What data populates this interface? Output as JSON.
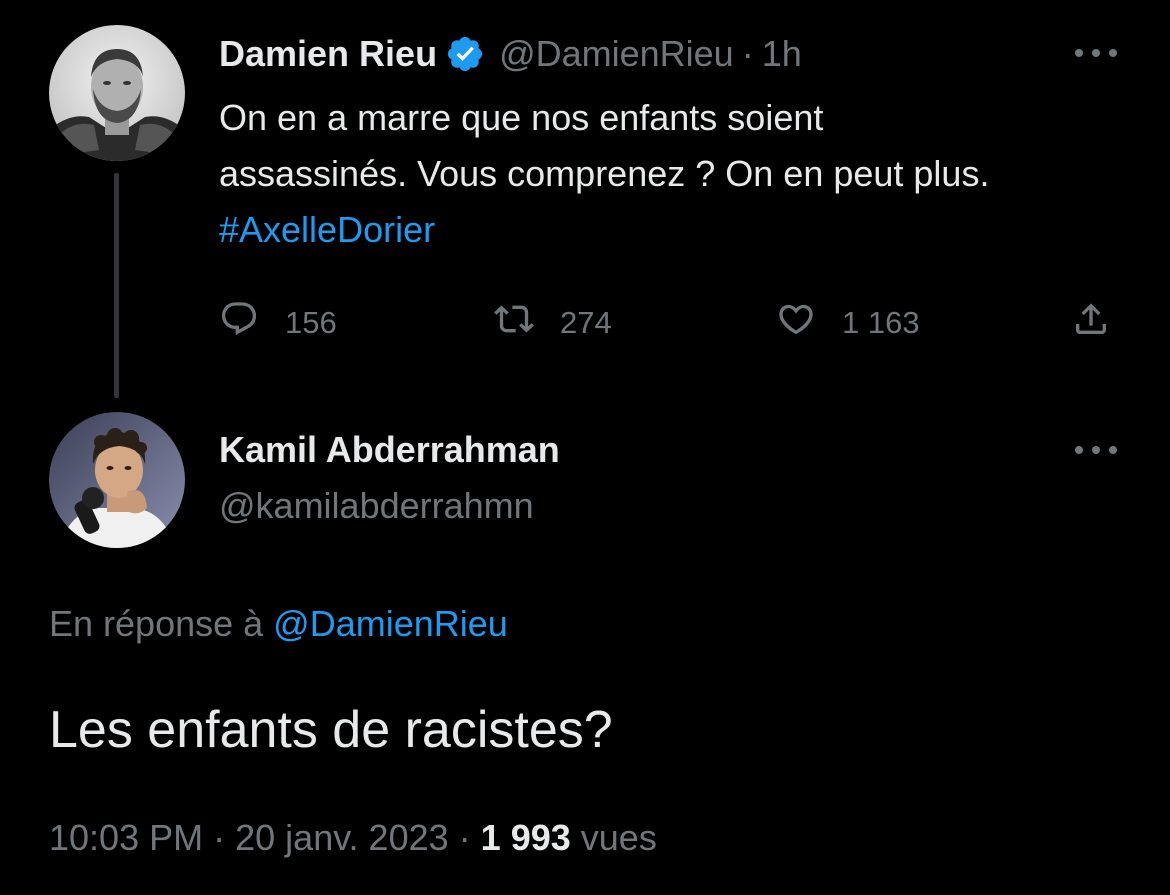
{
  "colors": {
    "background": "#000000",
    "text_primary": "#e7e9ea",
    "text_secondary": "#71767b",
    "accent": "#1d9bf0",
    "thread_line": "#333639"
  },
  "parent_tweet": {
    "display_name": "Damien Rieu",
    "verified_icon": "verified-badge-icon",
    "handle": "@DamienRieu",
    "separator": "·",
    "time_ago": "1h",
    "more_icon": "more-options-icon",
    "text_line1": "On en a marre que nos enfants soient",
    "text_line2": "assassinés. Vous comprenez ? On en peut plus.",
    "hashtag": "#AxelleDorier",
    "actions": {
      "replies_icon": "reply-icon",
      "replies": "156",
      "retweets_icon": "retweet-icon",
      "retweets": "274",
      "likes_icon": "heart-icon",
      "likes": "1 163",
      "share_icon": "share-icon"
    }
  },
  "reply_tweet": {
    "display_name": "Kamil Abderrahman",
    "handle": "@kamilabderrahmn",
    "more_icon": "more-options-icon",
    "in_reply_to_prefix": "En réponse à",
    "in_reply_to_handle": "@DamienRieu",
    "text": "Les enfants de racistes?",
    "time": "10:03 PM",
    "separator": "·",
    "date": "20 janv. 2023",
    "views_count": "1 993",
    "views_label": "vues"
  }
}
